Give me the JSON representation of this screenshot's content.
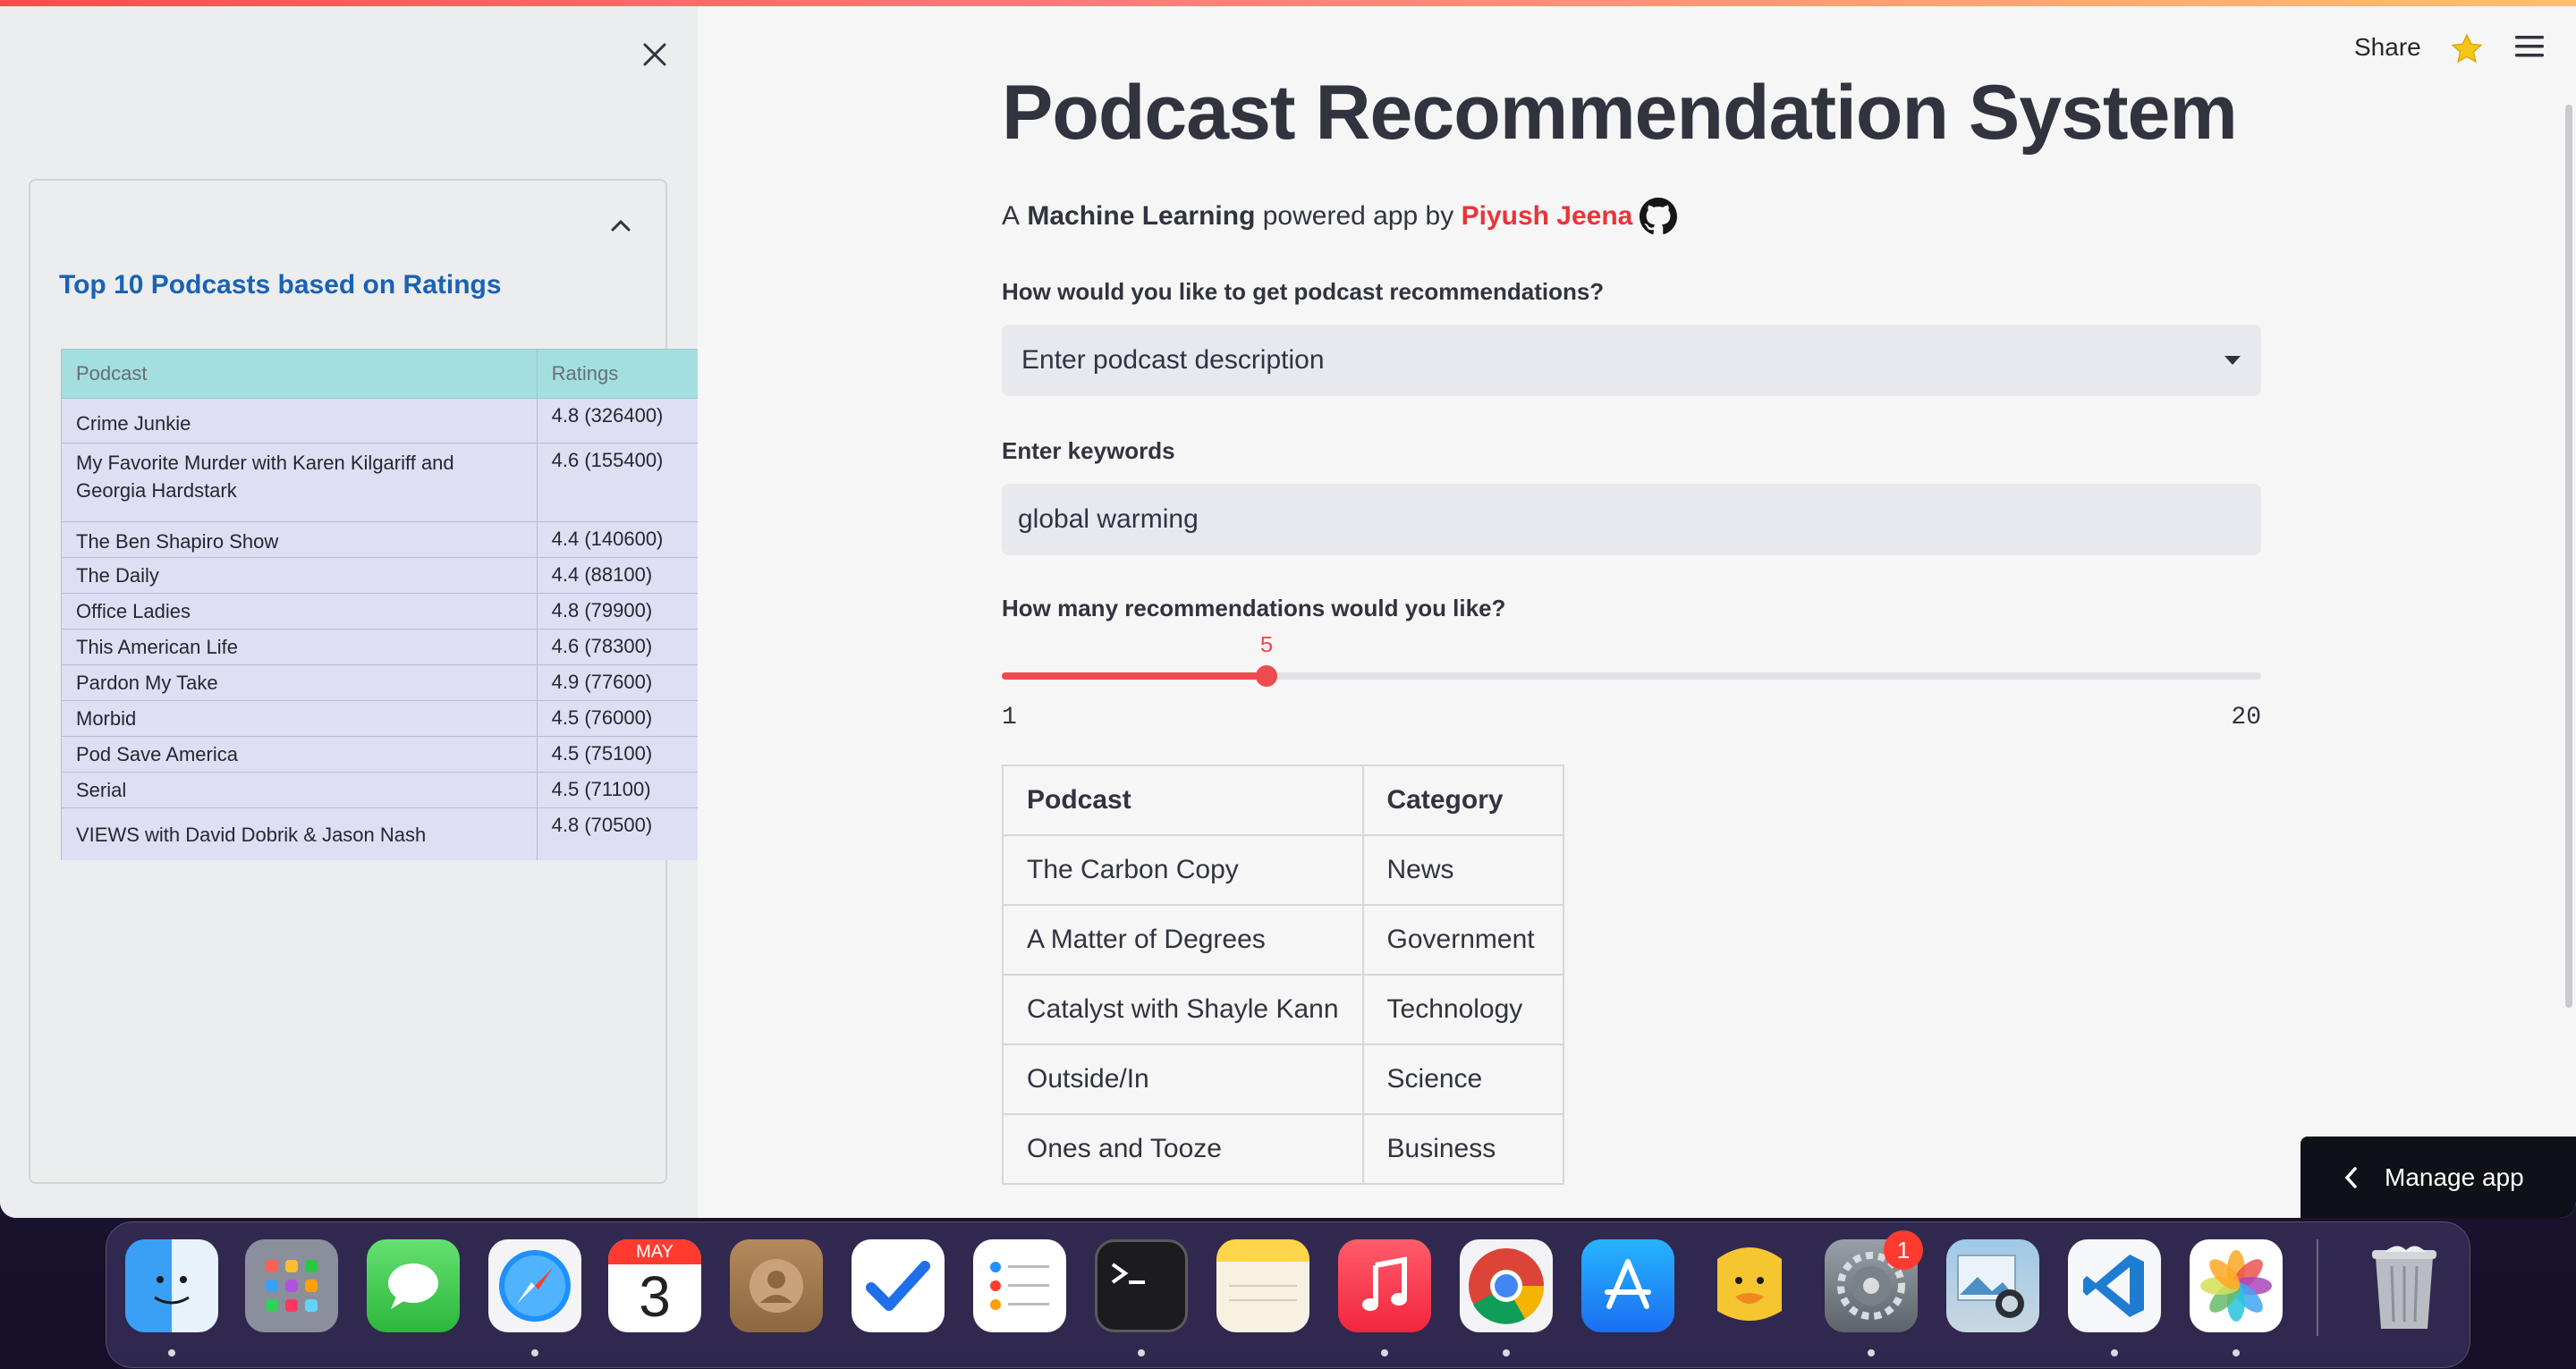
{
  "header": {
    "share_label": "Share"
  },
  "sidebar": {
    "expander_title": "Top 10 Podcasts based on Ratings",
    "table": {
      "headers": [
        "Podcast",
        "Ratings"
      ],
      "rows": [
        {
          "podcast": "Crime Junkie",
          "ratings": "4.8 (326400)"
        },
        {
          "podcast": "My Favorite Murder with Karen Kilgariff and Georgia Hardstark",
          "ratings": "4.6 (155400)"
        },
        {
          "podcast": "The Ben Shapiro Show",
          "ratings": "4.4 (140600)"
        },
        {
          "podcast": "The Daily",
          "ratings": "4.4 (88100)"
        },
        {
          "podcast": "Office Ladies",
          "ratings": "4.8 (79900)"
        },
        {
          "podcast": "This American Life",
          "ratings": "4.6 (78300)"
        },
        {
          "podcast": "Pardon My Take",
          "ratings": "4.9 (77600)"
        },
        {
          "podcast": "Morbid",
          "ratings": "4.5 (76000)"
        },
        {
          "podcast": "Pod Save America",
          "ratings": "4.5 (75100)"
        },
        {
          "podcast": "Serial",
          "ratings": "4.5 (71100)"
        },
        {
          "podcast": "VIEWS with David Dobrik & Jason Nash",
          "ratings": "4.8 (70500)"
        }
      ]
    }
  },
  "main": {
    "title": "Podcast Recommendation System",
    "byline": {
      "prefix": "A",
      "highlight": "Machine Learning",
      "middle": "powered app by",
      "author": "Piyush Jeena"
    },
    "method_label": "How would you like to get podcast recommendations?",
    "method_selected": "Enter podcast description",
    "keywords_label": "Enter keywords",
    "keywords_value": "global warming",
    "count_label": "How many recommendations would you like?",
    "slider": {
      "value": "5",
      "min": "1",
      "max": "20",
      "fraction": 0.2105
    },
    "results": {
      "headers": [
        "Podcast",
        "Category"
      ],
      "rows": [
        {
          "podcast": "The Carbon Copy",
          "category": "News"
        },
        {
          "podcast": "A Matter of Degrees",
          "category": "Government"
        },
        {
          "podcast": "Catalyst with Shayle Kann",
          "category": "Technology"
        },
        {
          "podcast": "Outside/In",
          "category": "Science"
        },
        {
          "podcast": "Ones and Tooze",
          "category": "Business"
        }
      ]
    },
    "manage_app_label": "Manage app"
  },
  "dock": {
    "calendar_month": "MAY",
    "calendar_day": "3",
    "settings_badge": "1",
    "apps": [
      "finder-icon",
      "launchpad-icon",
      "messages-icon",
      "safari-icon",
      "calendar-icon",
      "contacts-icon",
      "tasks-icon",
      "reminders-icon",
      "terminal-icon",
      "notes-icon",
      "music-icon",
      "chrome-icon",
      "app-store-icon",
      "cyberduck-icon",
      "system-settings-icon",
      "preview-icon",
      "vscode-icon",
      "photos-icon",
      "trash-icon"
    ]
  },
  "colors": {
    "accent": "#ef4a4f",
    "sidebar_title": "#1a62b4",
    "table_header": "#a3dfe0",
    "table_row": "#dedff5"
  }
}
